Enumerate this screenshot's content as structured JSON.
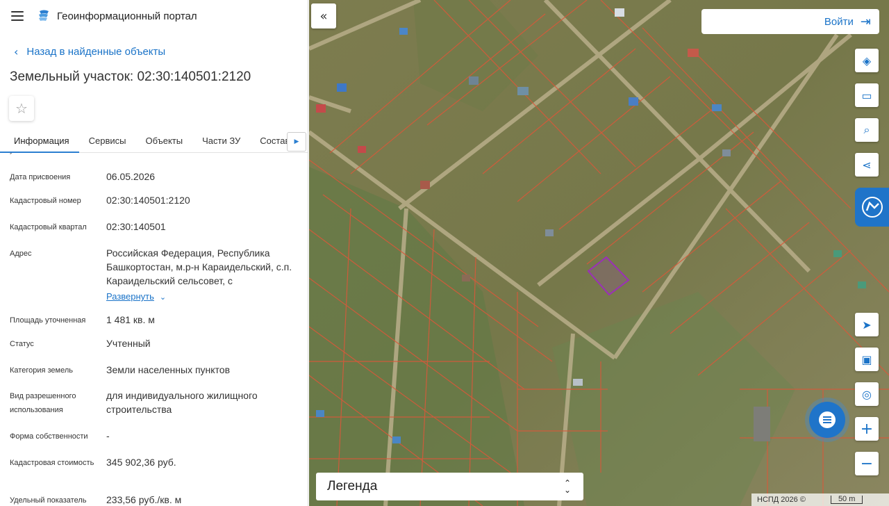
{
  "header": {
    "title": "Геоинформационный портал"
  },
  "back_link": "Назад в найденные объекты",
  "page_title": "Земельный участок: 02:30:140501:2120",
  "tabs": [
    "Информация",
    "Сервисы",
    "Объекты",
    "Части ЗУ",
    "Состав"
  ],
  "properties": {
    "cut_label": "участка",
    "date_label": "Дата присвоения",
    "date_value": "06.05.2026",
    "cad_num_label": "Кадастровый номер",
    "cad_num_value": "02:30:140501:2120",
    "quarter_label": "Кадастровый квартал",
    "quarter_value": "02:30:140501",
    "address_label": "Адрес",
    "address_value": "Российская Федерация, Республика Башкортостан, м.р-н Караидельский, с.п. Караидельский сельсовет, с",
    "expand_label": "Развернуть",
    "area_label": "Площадь уточненная",
    "area_value": "1 481 кв. м",
    "status_label": "Статус",
    "status_value": "Учтенный",
    "category_label": "Категория земель",
    "category_value": "Земли населенных пунктов",
    "use_label": "Вид разрешенного использования",
    "use_value": "для индивидуального жилищного строительства",
    "ownership_label": "Форма собственности",
    "ownership_value": "-",
    "cost_label": "Кадастровая стоимость",
    "cost_value": "345 902,36 руб.",
    "unit_label": "Удельный показатель",
    "unit_value": "233,56 руб./кв. м"
  },
  "map": {
    "login_label": "Войти",
    "legend_label": "Легенда",
    "copyright": "НСПД 2026 ©",
    "scale_label": "50 m"
  },
  "colors": {
    "accent": "#1f74c9",
    "link": "#1a73c8",
    "parcel_line": "#d9583a",
    "selected_parcel": "#9b2fb8"
  }
}
